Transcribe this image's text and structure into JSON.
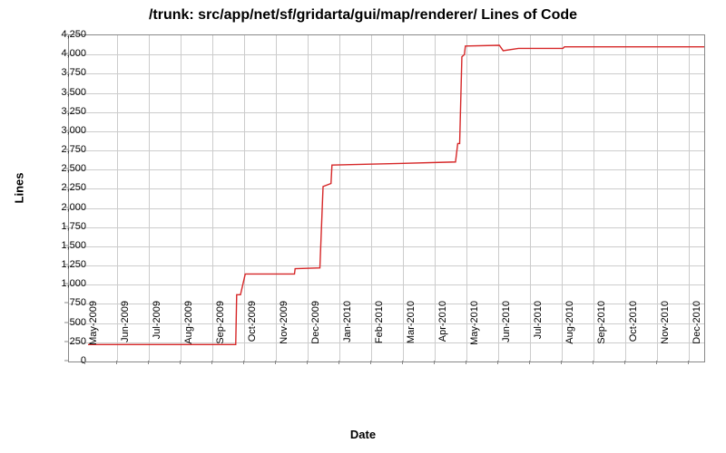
{
  "chart_data": {
    "type": "line",
    "title": "/trunk: src/app/net/sf/gridarta/gui/map/renderer/ Lines of Code",
    "xlabel": "Date",
    "ylabel": "Lines",
    "ylim": [
      0,
      4250
    ],
    "yticks": [
      0,
      250,
      500,
      750,
      1000,
      1250,
      1500,
      1750,
      2000,
      2250,
      2500,
      2750,
      3000,
      3250,
      3500,
      3750,
      4000,
      4250
    ],
    "xticks": [
      "May-2009",
      "Jun-2009",
      "Jul-2009",
      "Aug-2009",
      "Sep-2009",
      "Oct-2009",
      "Nov-2009",
      "Dec-2009",
      "Jan-2010",
      "Feb-2010",
      "Mar-2010",
      "Apr-2010",
      "May-2010",
      "Jun-2010",
      "Jul-2010",
      "Aug-2010",
      "Sep-2010",
      "Oct-2010",
      "Nov-2010",
      "Dec-2010"
    ],
    "series": [
      {
        "name": "Lines",
        "color": "#d62728",
        "points": [
          {
            "x": "2009-05-03",
            "xnum": 0.1,
            "y": 220
          },
          {
            "x": "2009-09-22",
            "xnum": 4.75,
            "y": 220
          },
          {
            "x": "2009-09-23",
            "xnum": 4.78,
            "y": 870
          },
          {
            "x": "2009-09-27",
            "xnum": 4.9,
            "y": 870
          },
          {
            "x": "2009-10-02",
            "xnum": 5.05,
            "y": 1140
          },
          {
            "x": "2009-11-18",
            "xnum": 6.6,
            "y": 1140
          },
          {
            "x": "2009-11-19",
            "xnum": 6.62,
            "y": 1210
          },
          {
            "x": "2009-12-12",
            "xnum": 7.4,
            "y": 1220
          },
          {
            "x": "2009-12-15",
            "xnum": 7.5,
            "y": 2280
          },
          {
            "x": "2009-12-23",
            "xnum": 7.75,
            "y": 2320
          },
          {
            "x": "2009-12-24",
            "xnum": 7.78,
            "y": 2560
          },
          {
            "x": "2010-02-25",
            "xnum": 9.9,
            "y": 2580
          },
          {
            "x": "2010-04-20",
            "xnum": 11.67,
            "y": 2600
          },
          {
            "x": "2010-04-22",
            "xnum": 11.74,
            "y": 2840
          },
          {
            "x": "2010-04-24",
            "xnum": 11.8,
            "y": 2840
          },
          {
            "x": "2010-04-26",
            "xnum": 11.87,
            "y": 3970
          },
          {
            "x": "2010-04-29",
            "xnum": 11.95,
            "y": 4000
          },
          {
            "x": "2010-04-30",
            "xnum": 11.98,
            "y": 4110
          },
          {
            "x": "2010-06-02",
            "xnum": 13.05,
            "y": 4120
          },
          {
            "x": "2010-06-05",
            "xnum": 13.17,
            "y": 4050
          },
          {
            "x": "2010-06-20",
            "xnum": 13.65,
            "y": 4080
          },
          {
            "x": "2010-08-01",
            "xnum": 15.05,
            "y": 4080
          },
          {
            "x": "2010-08-03",
            "xnum": 15.1,
            "y": 4100
          },
          {
            "x": "2010-12-20",
            "xnum": 19.7,
            "y": 4100
          }
        ]
      }
    ]
  }
}
